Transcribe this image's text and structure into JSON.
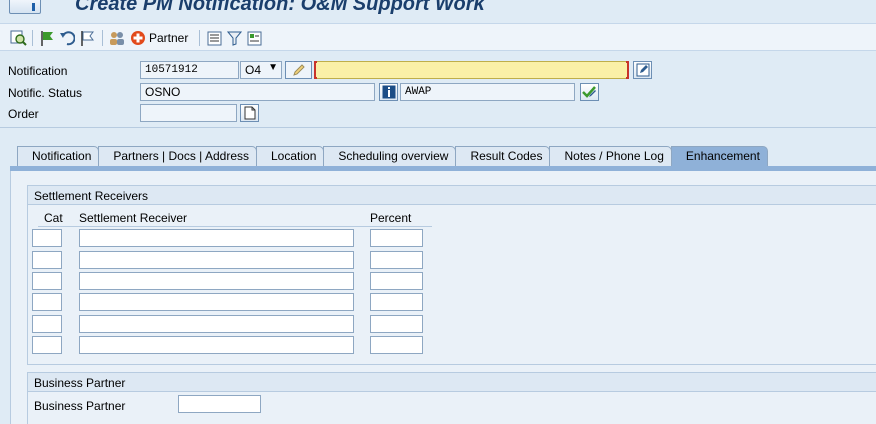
{
  "window": {
    "title": "Create PM Notification: O&M Support Work"
  },
  "toolbar": {
    "buttons": [
      {
        "icon": "magnifier-icon"
      },
      {
        "icon": "flag-icon"
      },
      {
        "icon": "undo-icon"
      },
      {
        "icon": "flag-outline-icon"
      },
      {
        "icon": "people-icon"
      },
      {
        "icon": "partner-icon",
        "label": "Partner"
      },
      {
        "icon": "list-icon"
      },
      {
        "icon": "filter-icon"
      },
      {
        "icon": "document-edit-icon"
      }
    ]
  },
  "header": {
    "notification_label": "Notification",
    "notification_number": "10571912",
    "notification_type": "O4",
    "notification_description": "",
    "status_label": "Notific. Status",
    "status_value": "OSNO",
    "user_status": "AWAP",
    "order_label": "Order",
    "order_value": ""
  },
  "tabs": [
    {
      "label": "Notification",
      "active": false
    },
    {
      "label": "Partners | Docs | Address",
      "active": false
    },
    {
      "label": "Location",
      "active": false
    },
    {
      "label": "Scheduling overview",
      "active": false
    },
    {
      "label": "Result Codes",
      "active": false
    },
    {
      "label": "Notes / Phone Log",
      "active": false
    },
    {
      "label": "Enhancement",
      "active": true
    }
  ],
  "settlement": {
    "group_title": "Settlement Receivers",
    "columns": [
      "Cat",
      "Settlement Receiver",
      "Percent"
    ],
    "rows": [
      {
        "cat": "",
        "receiver": "",
        "percent": ""
      },
      {
        "cat": "",
        "receiver": "",
        "percent": ""
      },
      {
        "cat": "",
        "receiver": "",
        "percent": ""
      },
      {
        "cat": "",
        "receiver": "",
        "percent": ""
      },
      {
        "cat": "",
        "receiver": "",
        "percent": ""
      },
      {
        "cat": "",
        "receiver": "",
        "percent": ""
      }
    ]
  },
  "business_partner": {
    "group_title": "Business Partner",
    "field_label": "Business Partner",
    "field_value": ""
  },
  "colors": {
    "background": "#dfebf5",
    "active_tab": "#8fb1d8",
    "required_field": "#fbf0a7",
    "title": "#1a3e6c"
  }
}
